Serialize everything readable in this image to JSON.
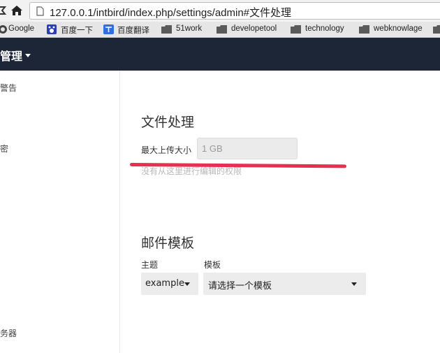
{
  "browser": {
    "url": "127.0.0.1/intbird/index.php/settings/admin#文件处理",
    "bookmarks": [
      {
        "label": "Google"
      },
      {
        "label": "百度一下"
      },
      {
        "label": "百度翻译"
      },
      {
        "label": "51work"
      },
      {
        "label": "developetool"
      },
      {
        "label": "technology"
      },
      {
        "label": "webknowlage"
      }
    ]
  },
  "header": {
    "title": "管理"
  },
  "sidebar": {
    "items": [
      {
        "label": "警告"
      },
      {
        "label": "密"
      },
      {
        "label": "务器"
      }
    ]
  },
  "file_handling": {
    "title": "文件处理",
    "max_upload_label": "最大上传大小",
    "max_upload_value": "1 GB",
    "no_permission_hint": "没有从这里进行编辑的权限"
  },
  "mail_templates": {
    "title": "邮件模板",
    "theme_label": "主题",
    "theme_value": "example",
    "template_label": "模板",
    "template_value": "请选择一个模板"
  },
  "colors": {
    "header_bg": "#1d2636",
    "annotation_red": "#e5314f"
  }
}
